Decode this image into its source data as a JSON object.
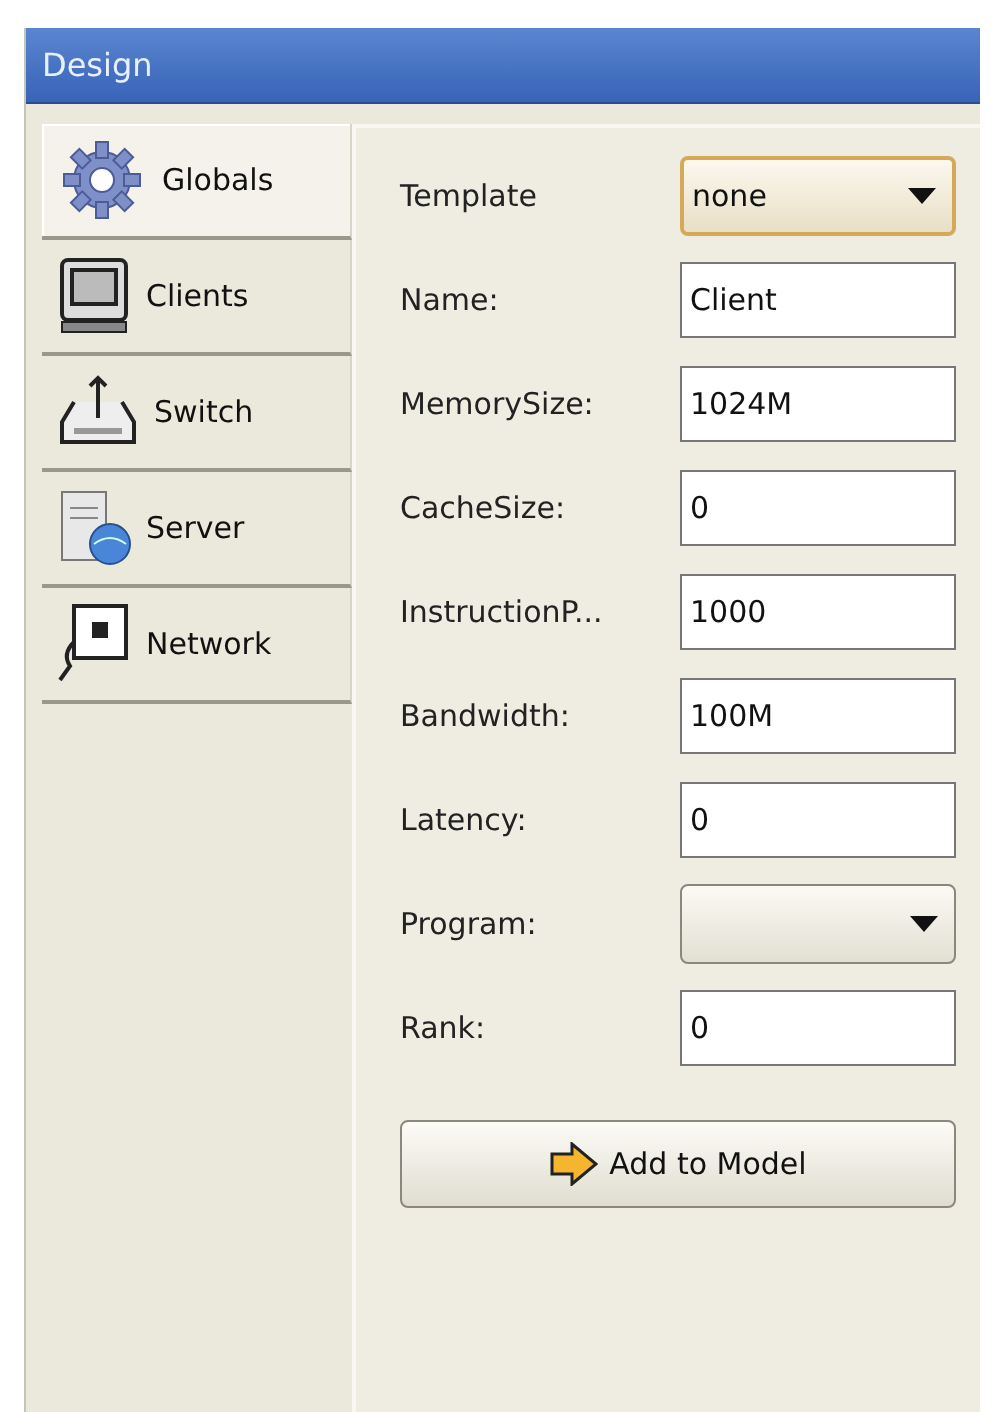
{
  "window": {
    "title": "Design"
  },
  "sidebar": {
    "items": [
      {
        "label": "Globals",
        "selected": true
      },
      {
        "label": "Clients",
        "selected": false
      },
      {
        "label": "Switch",
        "selected": false
      },
      {
        "label": "Server",
        "selected": false
      },
      {
        "label": "Network",
        "selected": false
      }
    ]
  },
  "form": {
    "fields": [
      {
        "kind": "dropdown",
        "label": "Template",
        "value": "none",
        "highlighted": true
      },
      {
        "kind": "text",
        "label": "Name:",
        "value": "Client"
      },
      {
        "kind": "text",
        "label": "MemorySize:",
        "value": "1024M"
      },
      {
        "kind": "text",
        "label": "CacheSize:",
        "value": "0"
      },
      {
        "kind": "text",
        "label": "InstructionP...",
        "value": "1000"
      },
      {
        "kind": "text",
        "label": "Bandwidth:",
        "value": "100M"
      },
      {
        "kind": "text",
        "label": "Latency:",
        "value": "0"
      },
      {
        "kind": "dropdown",
        "label": "Program:",
        "highlighted": false
      },
      {
        "kind": "text",
        "label": "Rank:",
        "value": "0"
      }
    ],
    "button": {
      "label": "Add to Model"
    }
  }
}
